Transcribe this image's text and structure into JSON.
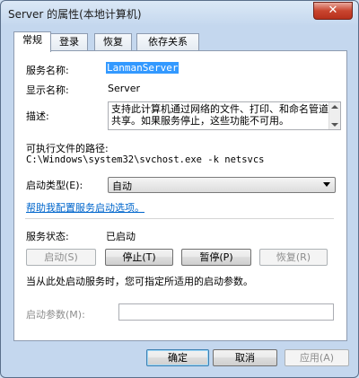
{
  "window": {
    "title": "Server 的属性(本地计算机)",
    "close_symbol": "✕"
  },
  "tabs": [
    {
      "label": "常规",
      "active": true
    },
    {
      "label": "登录",
      "active": false
    },
    {
      "label": "恢复",
      "active": false
    },
    {
      "label": "依存关系",
      "active": false
    }
  ],
  "general": {
    "service_name_label": "服务名称:",
    "service_name_value": "LanmanServer",
    "display_name_label": "显示名称:",
    "display_name_value": "Server",
    "description_label": "描述:",
    "description_value": "支持此计算机通过网络的文件、打印、和命名管道共享。如果服务停止，这些功能不可用。",
    "path_label": "可执行文件的路径:",
    "path_value": "C:\\Windows\\system32\\svchost.exe -k netsvcs",
    "startup_type_label": "启动类型(E):",
    "startup_type_value": "自动",
    "help_link": "帮助我配置服务启动选项。",
    "status_label": "服务状态:",
    "status_value": "已启动",
    "start_button": "启动(S)",
    "stop_button": "停止(T)",
    "pause_button": "暂停(P)",
    "resume_button": "恢复(R)",
    "hint_text": "当从此处启动服务时，您可指定所适用的启动参数。",
    "start_params_label": "启动参数(M):",
    "start_params_value": ""
  },
  "footer": {
    "ok_button": "确定",
    "cancel_button": "取消",
    "apply_button": "应用(A)"
  }
}
